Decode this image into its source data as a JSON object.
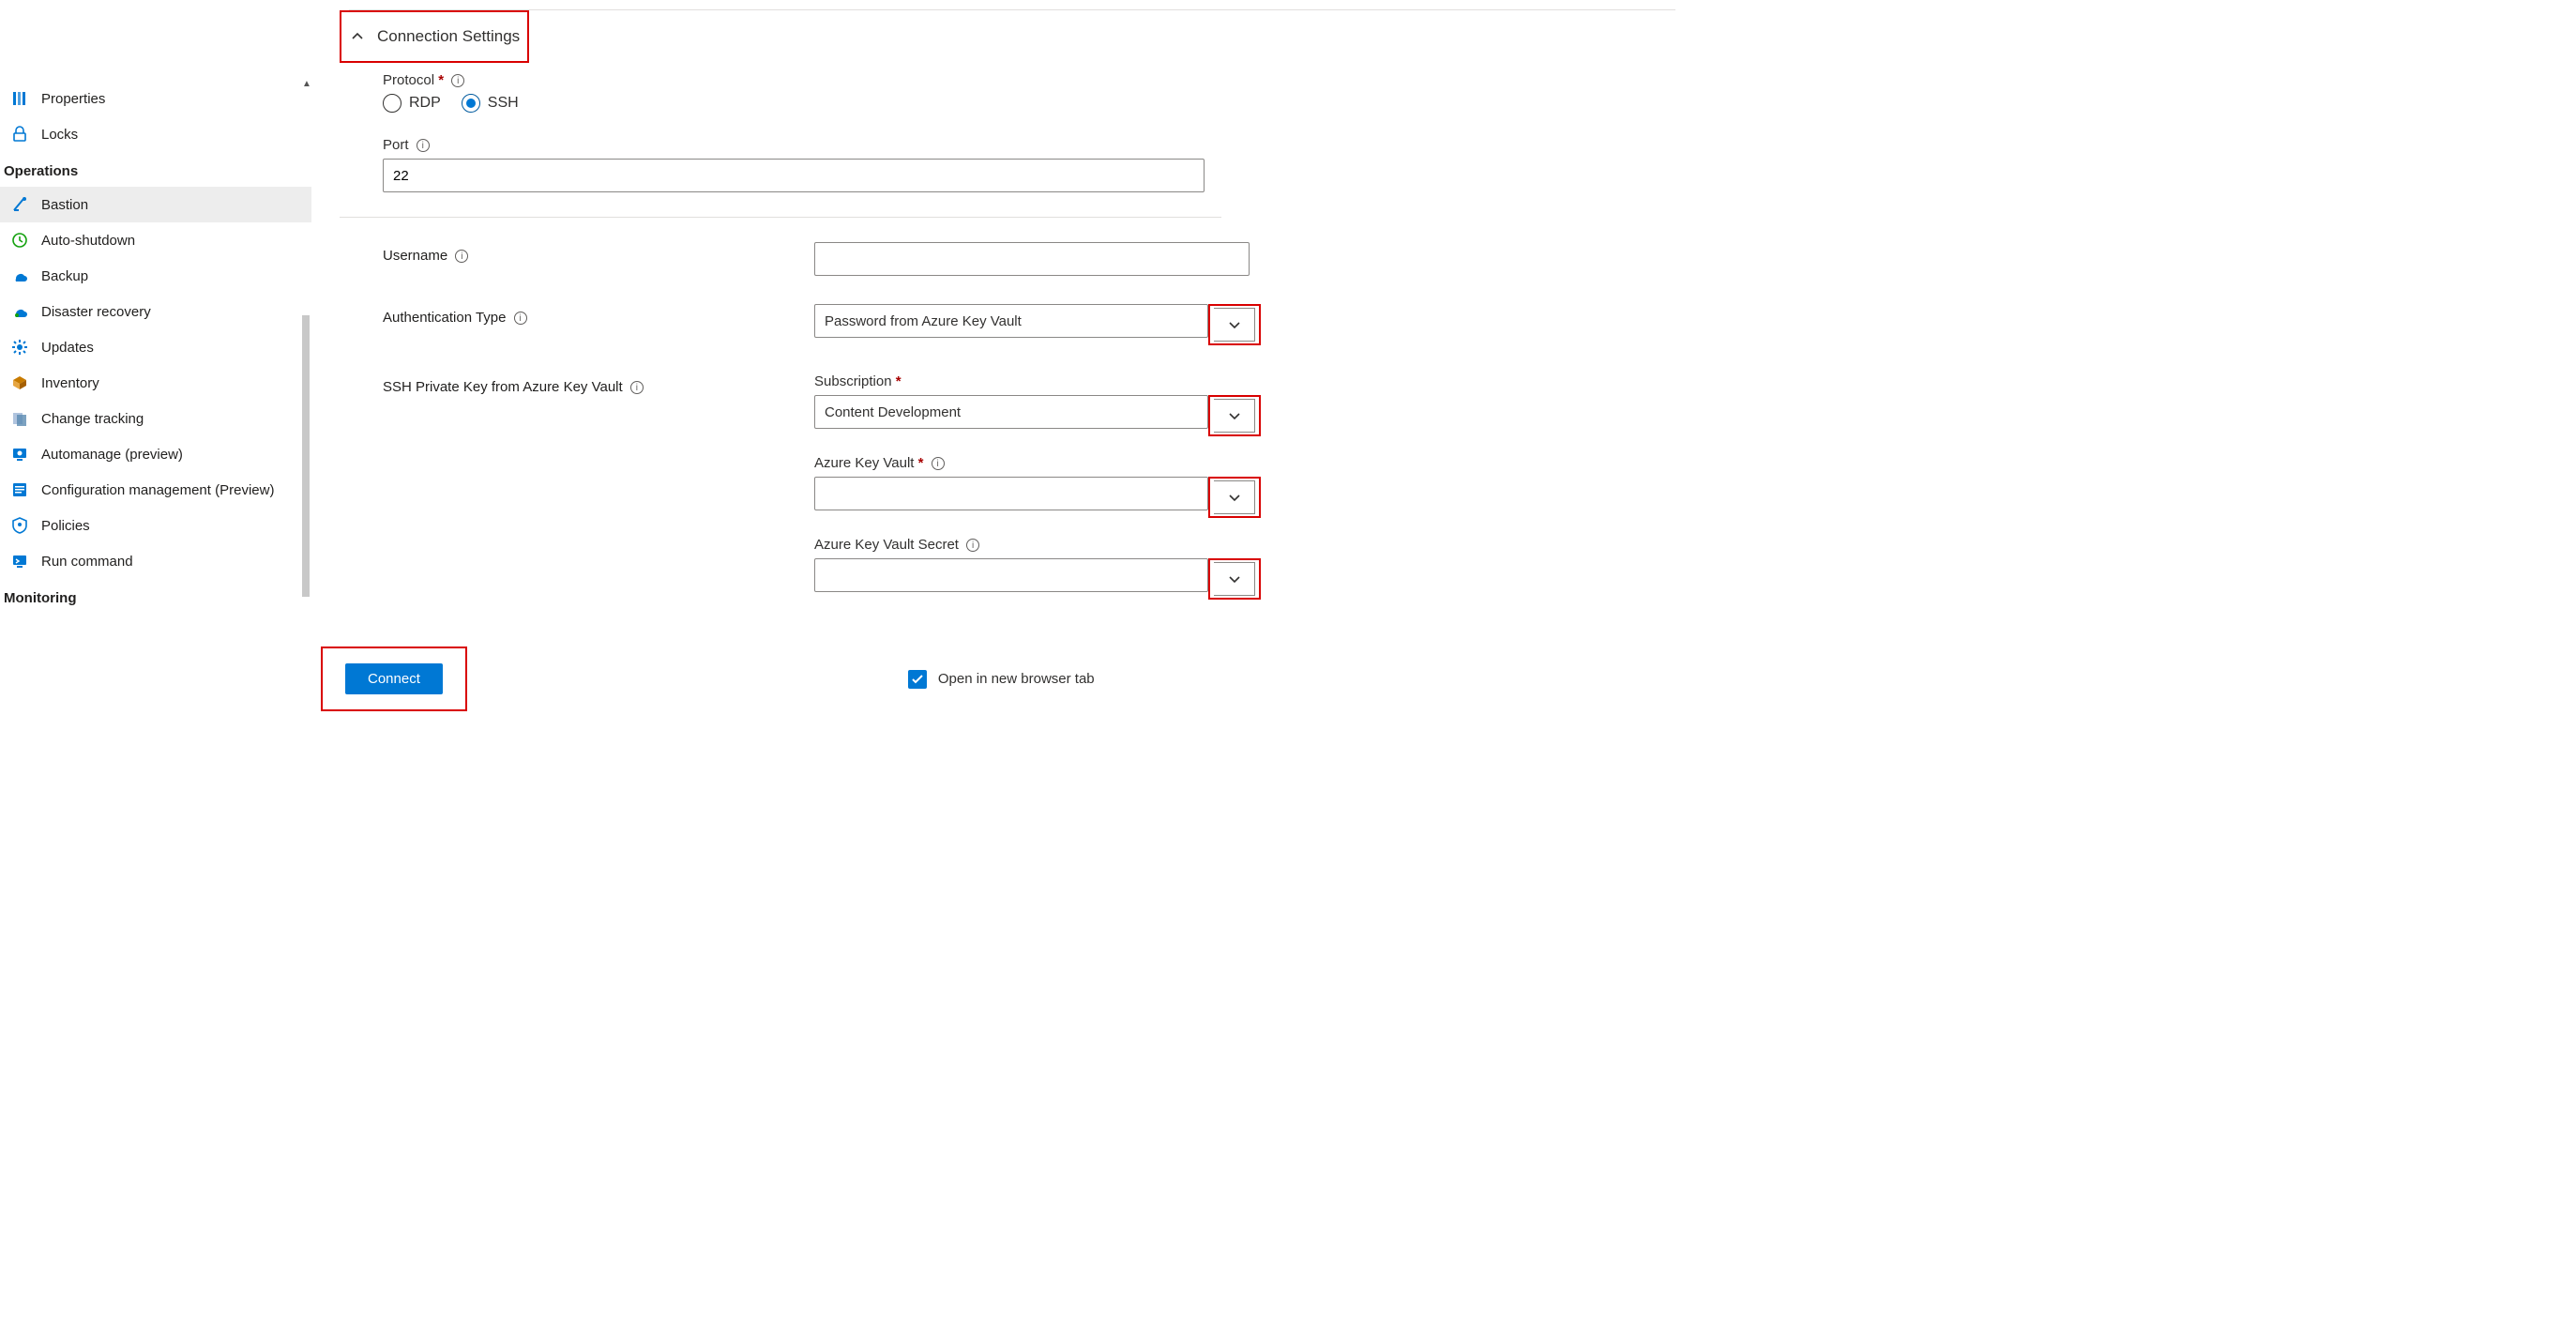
{
  "sidebar": {
    "items_top": [
      {
        "label": "Properties",
        "icon": "properties-icon"
      },
      {
        "label": "Locks",
        "icon": "lock-icon"
      }
    ],
    "section_operations": "Operations",
    "items_ops": [
      {
        "label": "Bastion",
        "icon": "bastion-icon",
        "selected": true
      },
      {
        "label": "Auto-shutdown",
        "icon": "clock-icon"
      },
      {
        "label": "Backup",
        "icon": "backup-icon"
      },
      {
        "label": "Disaster recovery",
        "icon": "dr-icon"
      },
      {
        "label": "Updates",
        "icon": "gear-icon"
      },
      {
        "label": "Inventory",
        "icon": "box-icon"
      },
      {
        "label": "Change tracking",
        "icon": "tracking-icon"
      },
      {
        "label": "Automanage (preview)",
        "icon": "automanage-icon"
      },
      {
        "label": "Configuration management (Preview)",
        "icon": "config-icon"
      },
      {
        "label": "Policies",
        "icon": "policies-icon"
      },
      {
        "label": "Run command",
        "icon": "run-icon"
      }
    ],
    "section_monitoring": "Monitoring"
  },
  "content": {
    "section_title": "Connection Settings",
    "protocol": {
      "label": "Protocol",
      "required": true,
      "options": {
        "rdp": "RDP",
        "ssh": "SSH"
      },
      "selected": "ssh"
    },
    "port": {
      "label": "Port",
      "value": "22"
    },
    "username": {
      "label": "Username",
      "value": ""
    },
    "auth_type": {
      "label": "Authentication Type",
      "value": "Password from Azure Key Vault"
    },
    "ssh_kv": {
      "label": "SSH Private Key from Azure Key Vault",
      "subscription": {
        "label": "Subscription",
        "required": true,
        "value": "Content Development"
      },
      "key_vault": {
        "label": "Azure Key Vault",
        "required": true,
        "value": ""
      },
      "key_vault_secret": {
        "label": "Azure Key Vault Secret",
        "value": ""
      }
    },
    "connect_button": "Connect",
    "open_new_tab": {
      "label": "Open in new browser tab",
      "checked": true
    }
  }
}
